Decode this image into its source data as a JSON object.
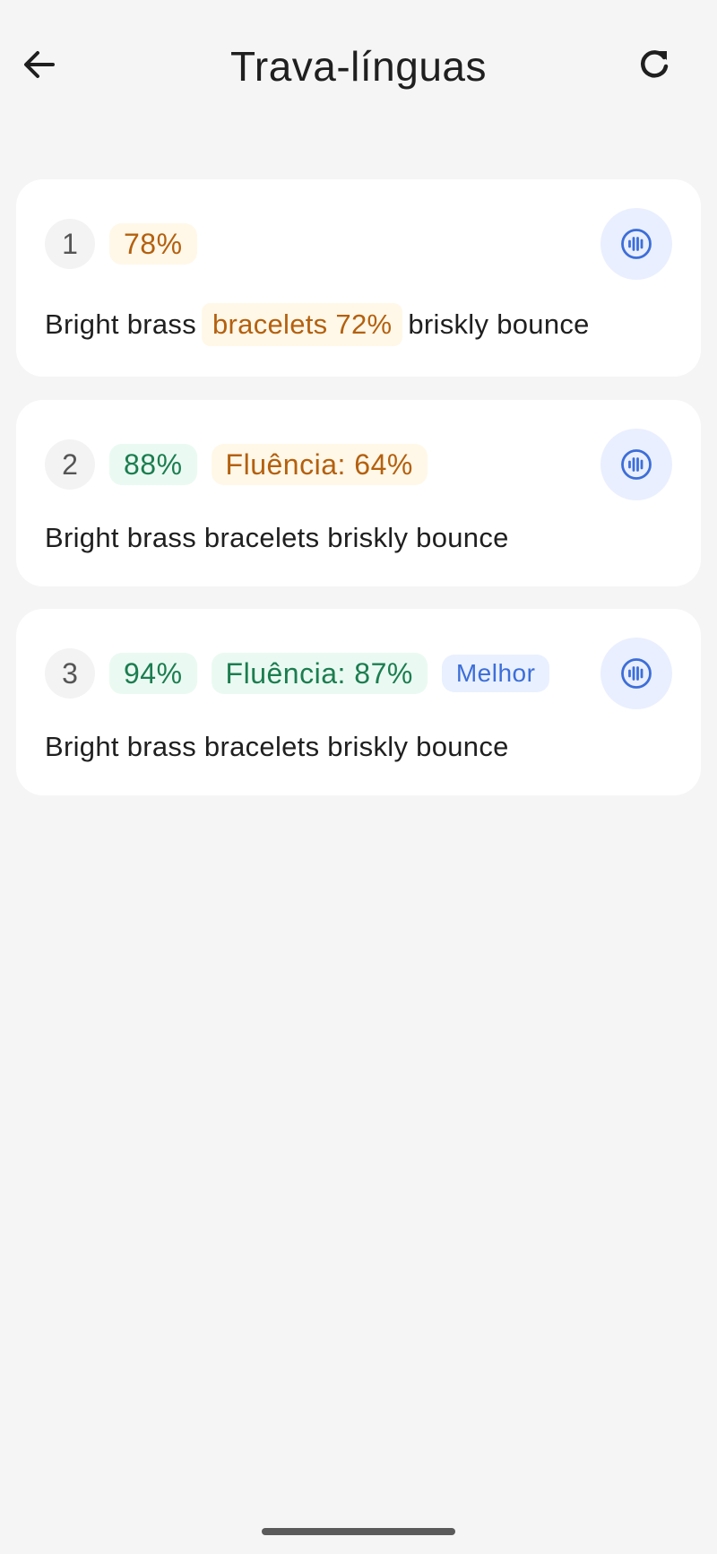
{
  "header": {
    "title": "Trava-línguas",
    "back_icon": "arrow-left-icon",
    "refresh_icon": "refresh-icon"
  },
  "attempts": [
    {
      "number": "1",
      "score": "78%",
      "sentence_before": "Bright brass",
      "sentence_highlight": "bracelets 72%",
      "sentence_after": "briskly bounce"
    },
    {
      "number": "2",
      "score": "88%",
      "fluency": "Fluência: 64%",
      "sentence": "Bright brass bracelets briskly bounce"
    },
    {
      "number": "3",
      "score": "94%",
      "fluency": "Fluência: 87%",
      "badge": "Melhor",
      "sentence": "Bright brass bracelets briskly bounce"
    }
  ],
  "colors": {
    "warning_text": "#b4600f",
    "warning_bg": "#fff8e8",
    "good_text": "#1c7d50",
    "good_bg": "#eafaf2",
    "accent": "#3d6ed8",
    "accent_bg": "#e9efff"
  },
  "play_icon": "audio-waveform-icon"
}
